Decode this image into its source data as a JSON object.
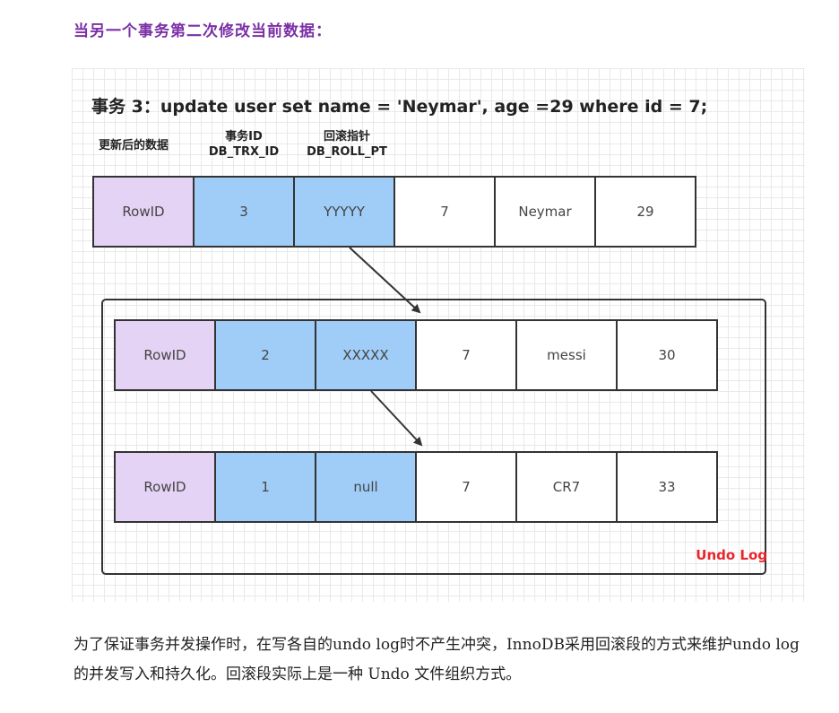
{
  "heading": "当另一个事务第二次修改当前数据：",
  "diagram": {
    "statement": "事务 3：update user set name = 'Neymar', age =29 where id = 7;",
    "col_headers": {
      "updated_data": "更新后的数据",
      "trx_id_cn": "事务ID",
      "trx_id": "DB_TRX_ID",
      "roll_ptr_cn": "回滚指针",
      "roll_ptr": "DB_ROLL_PT"
    },
    "current_row": [
      "RowID",
      "3",
      "YYYYY",
      "7",
      "Neymar",
      "29"
    ],
    "undo_log": {
      "label": "Undo Log",
      "rows": [
        [
          "RowID",
          "2",
          "XXXXX",
          "7",
          "messi",
          "30"
        ],
        [
          "RowID",
          "1",
          "null",
          "7",
          "CR7",
          "33"
        ]
      ]
    },
    "colors": {
      "rowid_fill": "#e4d3f5",
      "hidden_field_fill": "#9fcdf7",
      "undo_label": "#e8262c",
      "heading": "#7b2fa6"
    }
  },
  "paragraph": "为了保证事务并发操作时，在写各自的undo log时不产生冲突，InnoDB采用回滚段的方式来维护undo log的并发写入和持久化。回滚段实际上是一种 Undo 文件组织方式。"
}
